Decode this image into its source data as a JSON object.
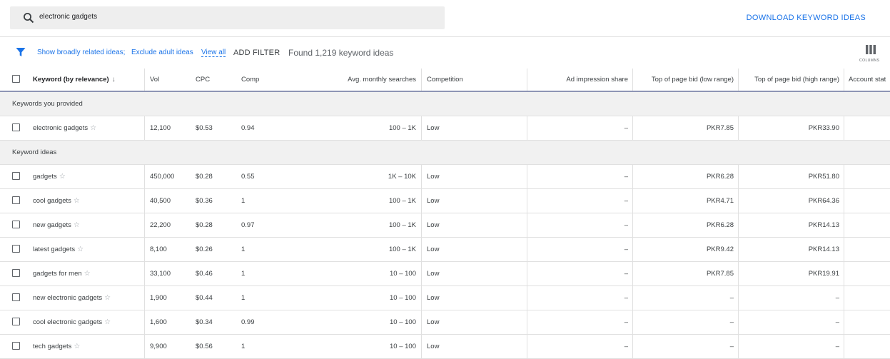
{
  "search": {
    "query": "electronic gadgets"
  },
  "toolbar": {
    "download_label": "DOWNLOAD KEYWORD IDEAS"
  },
  "filters": {
    "show_broad": "Show broadly related ideas;",
    "exclude_adult": "Exclude adult ideas",
    "view_all": "View all",
    "add_filter": "ADD FILTER",
    "found": "Found 1,219 keyword ideas",
    "columns_label": "COLUMNS"
  },
  "table": {
    "headers": {
      "keyword": "Keyword (by relevance)",
      "sort_arrow": "↓",
      "vol": "Vol",
      "cpc": "CPC",
      "comp": "Comp",
      "avg": "Avg. monthly searches",
      "competition": "Competition",
      "impr": "Ad impression share",
      "low": "Top of page bid (low range)",
      "high": "Top of page bid (high range)",
      "account": "Account stat"
    },
    "groups": [
      {
        "label": "Keywords you provided",
        "rows": [
          {
            "keyword": "electronic gadgets",
            "vol": "12,100",
            "cpc": "$0.53",
            "comp": "0.94",
            "avg": "100 – 1K",
            "competition": "Low",
            "impr": "–",
            "low": "PKR7.85",
            "high": "PKR33.90"
          }
        ]
      },
      {
        "label": "Keyword ideas",
        "rows": [
          {
            "keyword": "gadgets",
            "vol": "450,000",
            "cpc": "$0.28",
            "comp": "0.55",
            "avg": "1K – 10K",
            "competition": "Low",
            "impr": "–",
            "low": "PKR6.28",
            "high": "PKR51.80"
          },
          {
            "keyword": "cool gadgets",
            "vol": "40,500",
            "cpc": "$0.36",
            "comp": "1",
            "avg": "100 – 1K",
            "competition": "Low",
            "impr": "–",
            "low": "PKR4.71",
            "high": "PKR64.36"
          },
          {
            "keyword": "new gadgets",
            "vol": "22,200",
            "cpc": "$0.28",
            "comp": "0.97",
            "avg": "100 – 1K",
            "competition": "Low",
            "impr": "–",
            "low": "PKR6.28",
            "high": "PKR14.13"
          },
          {
            "keyword": "latest gadgets",
            "vol": "8,100",
            "cpc": "$0.26",
            "comp": "1",
            "avg": "100 – 1K",
            "competition": "Low",
            "impr": "–",
            "low": "PKR9.42",
            "high": "PKR14.13"
          },
          {
            "keyword": "gadgets for men",
            "vol": "33,100",
            "cpc": "$0.46",
            "comp": "1",
            "avg": "10 – 100",
            "competition": "Low",
            "impr": "–",
            "low": "PKR7.85",
            "high": "PKR19.91"
          },
          {
            "keyword": "new electronic gadgets",
            "vol": "1,900",
            "cpc": "$0.44",
            "comp": "1",
            "avg": "10 – 100",
            "competition": "Low",
            "impr": "–",
            "low": "–",
            "high": "–"
          },
          {
            "keyword": "cool electronic gadgets",
            "vol": "1,600",
            "cpc": "$0.34",
            "comp": "0.99",
            "avg": "10 – 100",
            "competition": "Low",
            "impr": "–",
            "low": "–",
            "high": "–"
          },
          {
            "keyword": "tech gadgets",
            "vol": "9,900",
            "cpc": "$0.56",
            "comp": "1",
            "avg": "10 – 100",
            "competition": "Low",
            "impr": "–",
            "low": "–",
            "high": "–"
          }
        ]
      }
    ]
  },
  "colors": {
    "accent": "#1a73e8",
    "header_rule": "#8e95b5",
    "group_bg": "#f1f1f1"
  },
  "icons": {
    "search": "search-icon",
    "filter": "filter-icon",
    "columns": "columns-icon",
    "star": "star-icon"
  }
}
